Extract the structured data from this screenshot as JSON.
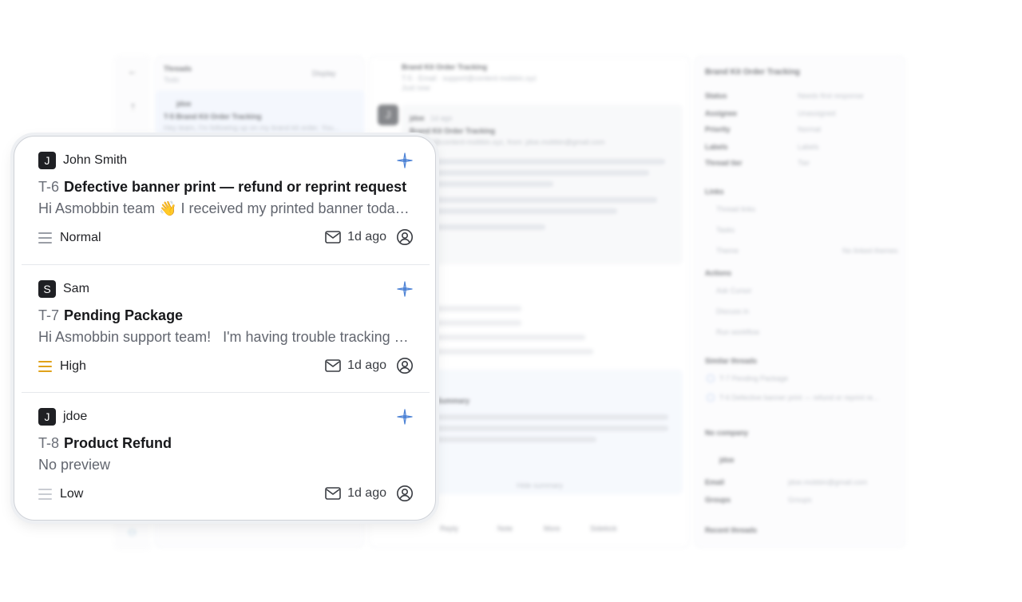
{
  "background": {
    "threads_header": "Threads",
    "threads_sub": "Todo",
    "display_label": "Display",
    "bg_thread_author": "jdoe",
    "bg_thread_title": "T-5 Brand Kit Order Tracking",
    "bg_thread_preview": "Hey team, I'm following up on my brand kit order. You...",
    "conv_title": "Brand Kit Order Tracking",
    "conv_sub": "T-5 · Email · support@content-mobbin.xyz",
    "conv_sub2": "Just now",
    "msg_author": "jdoe",
    "msg_time": "1d ago",
    "msg_title": "Brand Kit Order Tracking",
    "msg_to": "support@content-mobbin.xyz, from: jdoe.mobbin@gmail.com",
    "summary_label": "Summary",
    "hide_summary": "Hide summary",
    "reply_label": "Reply",
    "note_label": "Note",
    "more_label": "More",
    "sidekick_label": "Sidekick",
    "side_title": "Brand Kit Order Tracking",
    "side_fields": [
      {
        "k": "Status",
        "v": "Needs first response"
      },
      {
        "k": "Assignee",
        "v": "Unassigned"
      },
      {
        "k": "Priority",
        "v": "Normal"
      },
      {
        "k": "Labels",
        "v": "Labels"
      },
      {
        "k": "Thread tier",
        "v": "Tier"
      }
    ],
    "links_label": "Links",
    "thread_links": "Thread links",
    "tasks_label": "Tasks",
    "theme_label": "Theme",
    "no_themes": "No linked themes",
    "actions_label": "Actions",
    "ask_cursor": "Ask Cursor",
    "discuss_in": "Discuss in",
    "run_workflow": "Run workflow",
    "similar_threads": "Similar threads",
    "similar_1": "T-7 Pending Package",
    "similar_2": "T-6 Defective banner print — refund or reprint re...",
    "no_company": "No company",
    "side_user": "jdoe",
    "email_label": "Email",
    "email_value": "jdoe.mobbin@gmail.com",
    "groups_label": "Groups",
    "groups_value": "Groups",
    "recent_threads": "Recent threads"
  },
  "threads": [
    {
      "avatar": "J",
      "author": "John Smith",
      "id": "T-6",
      "title": "Defective banner print — refund or reprint request",
      "preview": "Hi Asmobbin team 👋 I received my printed banner today and it looks damaged",
      "priority": "Normal",
      "priority_level": "normal",
      "time": "1d ago"
    },
    {
      "avatar": "S",
      "author": "Sam",
      "id": "T-7",
      "title": "Pending Package",
      "preview": "Hi Asmobbin support team!   I'm having trouble tracking my package",
      "priority": "High",
      "priority_level": "high",
      "time": "1d ago"
    },
    {
      "avatar": "J",
      "author": "jdoe",
      "id": "T-8",
      "title": "Product Refund",
      "preview": "No preview",
      "priority": "Low",
      "priority_level": "low",
      "time": "1d ago"
    }
  ],
  "colors": {
    "high_priority": "#e0a21a",
    "normal_priority": "#9a9ea6",
    "low_priority": "#c9ccd2",
    "spark_blue": "#4f84d6"
  },
  "icons": {
    "thread_action": "sparkle-icon",
    "channel": "mail-icon",
    "assignee": "user-circle-icon"
  }
}
